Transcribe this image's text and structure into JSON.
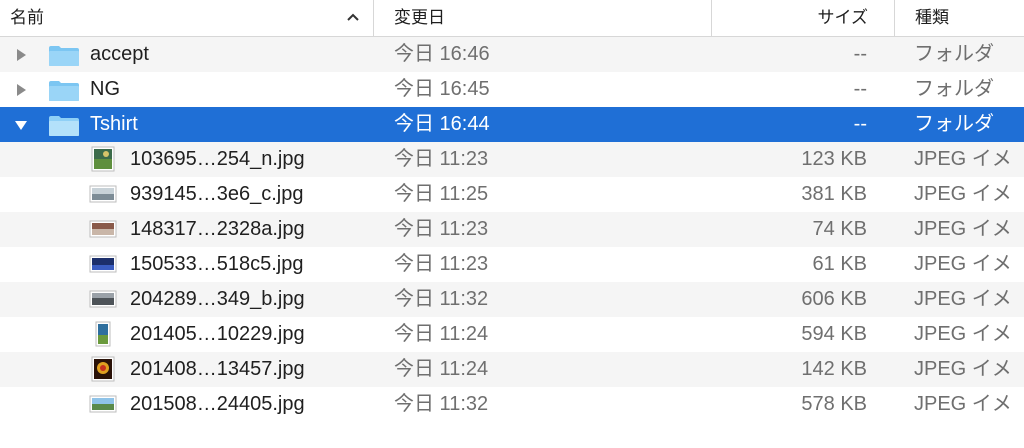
{
  "columns": {
    "name": "名前",
    "date": "変更日",
    "size": "サイズ",
    "kind": "種類"
  },
  "folders": [
    {
      "name": "accept",
      "date": "今日 16:46",
      "size": "--",
      "kind": "フォルダ",
      "expanded": false
    },
    {
      "name": "NG",
      "date": "今日 16:45",
      "size": "--",
      "kind": "フォルダ",
      "expanded": false
    },
    {
      "name": "Tshirt",
      "date": "今日 16:44",
      "size": "--",
      "kind": "フォルダ",
      "expanded": true,
      "selected": true
    }
  ],
  "files": [
    {
      "name": "103695…254_n.jpg",
      "date": "今日 11:23",
      "size": "123 KB",
      "kind": "JPEG イメ"
    },
    {
      "name": "939145…3e6_c.jpg",
      "date": "今日 11:25",
      "size": "381 KB",
      "kind": "JPEG イメ"
    },
    {
      "name": "148317…2328a.jpg",
      "date": "今日 11:23",
      "size": "74 KB",
      "kind": "JPEG イメ"
    },
    {
      "name": "150533…518c5.jpg",
      "date": "今日 11:23",
      "size": "61 KB",
      "kind": "JPEG イメ"
    },
    {
      "name": "204289…349_b.jpg",
      "date": "今日 11:32",
      "size": "606 KB",
      "kind": "JPEG イメ"
    },
    {
      "name": "201405…10229.jpg",
      "date": "今日 11:24",
      "size": "594 KB",
      "kind": "JPEG イメ"
    },
    {
      "name": "201408…13457.jpg",
      "date": "今日 11:24",
      "size": "142 KB",
      "kind": "JPEG イメ"
    },
    {
      "name": "201508…24405.jpg",
      "date": "今日 11:32",
      "size": "578 KB",
      "kind": "JPEG イメ"
    }
  ],
  "colors": {
    "selection": "#1f6fd6",
    "folder": "#7cc6f2",
    "alt_row": "#f5f5f5"
  },
  "icons": {
    "sort": "chevron-up-icon",
    "collapsed": "disclosure-right-icon",
    "expanded": "disclosure-down-icon",
    "folder": "folder-icon",
    "file": "image-thumbnail-icon"
  }
}
